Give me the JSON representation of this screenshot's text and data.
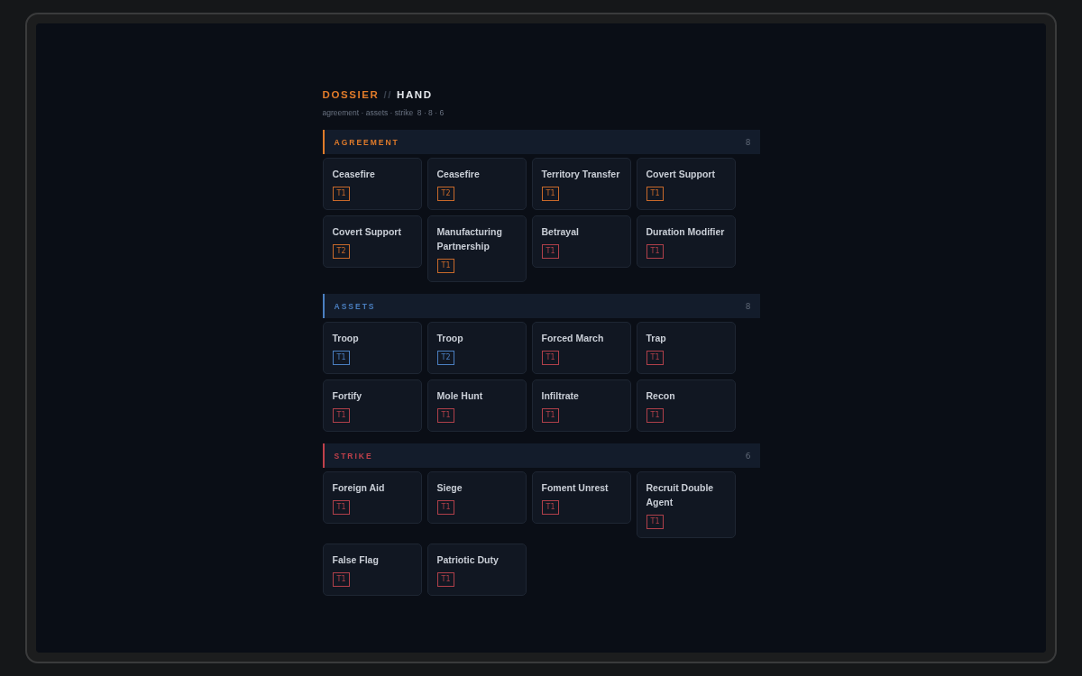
{
  "title": {
    "prefix": "DOSSIER",
    "separator": "//",
    "name": "HAND"
  },
  "subtitle": "agreement · assets · strike  8 · 8 · 6",
  "sections": [
    {
      "name": "AGREEMENT",
      "count": "8",
      "color": "#e07b2a",
      "cards": [
        {
          "name": "Ceasefire",
          "tier": "T1",
          "color": "#c8692a"
        },
        {
          "name": "Ceasefire",
          "tier": "T2",
          "color": "#c8692a"
        },
        {
          "name": "Territory Transfer",
          "tier": "T1",
          "color": "#c8692a"
        },
        {
          "name": "Covert Support",
          "tier": "T1",
          "color": "#c8692a"
        },
        {
          "name": "Covert Support",
          "tier": "T2",
          "color": "#c8692a"
        },
        {
          "name": "Manufacturing Partnership",
          "tier": "T1",
          "color": "#c8692a"
        },
        {
          "name": "Betrayal",
          "tier": "T1",
          "color": "#b0404a"
        },
        {
          "name": "Duration Modifier",
          "tier": "T1",
          "color": "#b0404a"
        }
      ]
    },
    {
      "name": "ASSETS",
      "count": "8",
      "color": "#4a7fc1",
      "cards": [
        {
          "name": "Troop",
          "tier": "T1",
          "color": "#4a7fc1"
        },
        {
          "name": "Troop",
          "tier": "T2",
          "color": "#4a7fc1"
        },
        {
          "name": "Forced March",
          "tier": "T1",
          "color": "#b0404a"
        },
        {
          "name": "Trap",
          "tier": "T1",
          "color": "#b0404a"
        },
        {
          "name": "Fortify",
          "tier": "T1",
          "color": "#b0404a"
        },
        {
          "name": "Mole Hunt",
          "tier": "T1",
          "color": "#b0404a"
        },
        {
          "name": "Infiltrate",
          "tier": "T1",
          "color": "#b0404a"
        },
        {
          "name": "Recon",
          "tier": "T1",
          "color": "#b0404a"
        }
      ]
    },
    {
      "name": "STRIKE",
      "count": "6",
      "color": "#c0404a",
      "cards": [
        {
          "name": "Foreign Aid",
          "tier": "T1",
          "color": "#b0404a"
        },
        {
          "name": "Siege",
          "tier": "T1",
          "color": "#b0404a"
        },
        {
          "name": "Foment Unrest",
          "tier": "T1",
          "color": "#b0404a"
        },
        {
          "name": "Recruit Double Agent",
          "tier": "T1",
          "color": "#b0404a"
        },
        {
          "name": "False Flag",
          "tier": "T1",
          "color": "#b0404a"
        },
        {
          "name": "Patriotic Duty",
          "tier": "T1",
          "color": "#b0404a"
        }
      ]
    }
  ]
}
